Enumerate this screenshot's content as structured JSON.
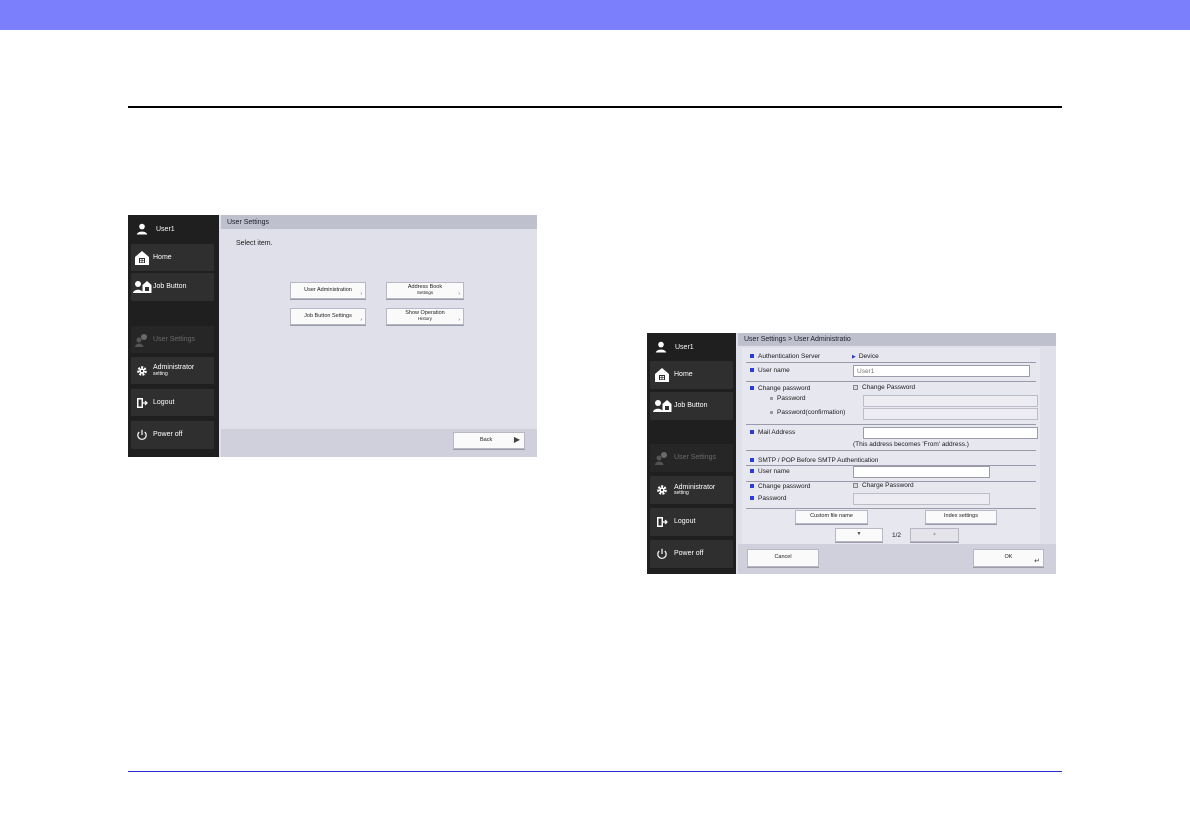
{
  "colors": {
    "band": "#7b7ffb",
    "rule_bottom": "#2a2ad6",
    "sidebar": "#1f1f1f",
    "accent_square": "#2b3bd8"
  },
  "screen1": {
    "user": "User1",
    "sidebar": {
      "home": "Home",
      "job_button": "Job Button",
      "user_settings": "User Settings",
      "admin_line1": "Administrator",
      "admin_line2": "setting",
      "logout": "Logout",
      "power_off": "Power off"
    },
    "title": "User Settings",
    "instruction": "Select item.",
    "buttons": {
      "user_admin": "User Administration",
      "address_book_1": "Address Book",
      "address_book_2": "Settings",
      "job_button_settings": "Job Button Settings",
      "show_op_1": "Show Operation",
      "show_op_2": "History",
      "back": "Back"
    }
  },
  "screen2": {
    "user": "User1",
    "sidebar": {
      "home": "Home",
      "job_button": "Job Button",
      "user_settings": "User Settings",
      "admin_line1": "Administrator",
      "admin_line2": "setting",
      "logout": "Logout",
      "power_off": "Power off"
    },
    "title": "User Settings > User Administratio",
    "form": {
      "auth_server_label": "Authentication Server",
      "auth_server_value": "Device",
      "user_name_label": "User name",
      "user_name_value": "User1",
      "change_password_label": "Change password",
      "change_password_check": "Change Password",
      "password_label": "Password",
      "password_confirm_label": "Password(confirmation)",
      "mail_address_label": "Mail Address",
      "mail_note": "(This address becomes 'From' address.)",
      "smtp_heading": "SMTP / POP Before SMTP Authentication",
      "smtp_user_label": "User name",
      "smtp_change_password_label": "Change password",
      "smtp_change_password_check": "Charge Password",
      "smtp_password_label": "Password",
      "custom_file_name": "Custom file name",
      "index_settings": "Index settings",
      "page_indicator": "1/2",
      "cancel": "Cancel",
      "ok": "OK"
    }
  }
}
